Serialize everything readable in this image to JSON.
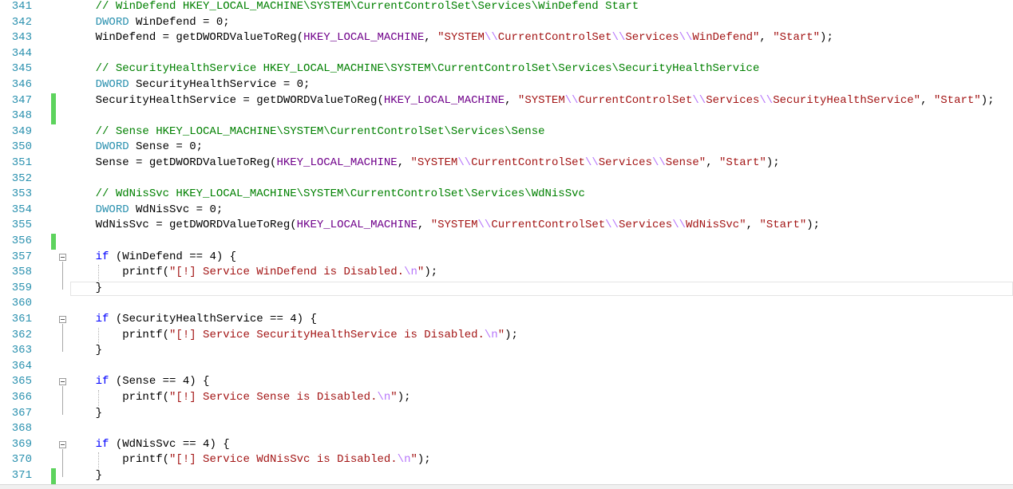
{
  "editor": {
    "lines": [
      {
        "n": "341",
        "tokens": [
          {
            "t": "    "
          },
          {
            "t": "// WinDefend HKEY_LOCAL_MACHINE\\SYSTEM\\CurrentControlSet\\Services\\WinDefend Start",
            "c": "comment"
          }
        ]
      },
      {
        "n": "342",
        "tokens": [
          {
            "t": "    "
          },
          {
            "t": "DWORD",
            "c": "type"
          },
          {
            "t": " WinDefend = 0;"
          }
        ]
      },
      {
        "n": "343",
        "tokens": [
          {
            "t": "    WinDefend = getDWORDValueToReg("
          },
          {
            "t": "HKEY_LOCAL_MACHINE",
            "c": "macro"
          },
          {
            "t": ", "
          },
          {
            "t": "\"SYSTEM",
            "c": "str"
          },
          {
            "t": "\\\\",
            "c": "esc"
          },
          {
            "t": "CurrentControlSet",
            "c": "str"
          },
          {
            "t": "\\\\",
            "c": "esc"
          },
          {
            "t": "Services",
            "c": "str"
          },
          {
            "t": "\\\\",
            "c": "esc"
          },
          {
            "t": "WinDefend\"",
            "c": "str"
          },
          {
            "t": ", "
          },
          {
            "t": "\"Start\"",
            "c": "str"
          },
          {
            "t": ");"
          }
        ]
      },
      {
        "n": "344",
        "tokens": []
      },
      {
        "n": "345",
        "tokens": [
          {
            "t": "    "
          },
          {
            "t": "// SecurityHealthService HKEY_LOCAL_MACHINE\\SYSTEM\\CurrentControlSet\\Services\\SecurityHealthService",
            "c": "comment"
          }
        ]
      },
      {
        "n": "346",
        "tokens": [
          {
            "t": "    "
          },
          {
            "t": "DWORD",
            "c": "type"
          },
          {
            "t": " SecurityHealthService = 0;"
          }
        ]
      },
      {
        "n": "347",
        "change": true,
        "tokens": [
          {
            "t": "    SecurityHealthService = getDWORDValueToReg("
          },
          {
            "t": "HKEY_LOCAL_MACHINE",
            "c": "macro"
          },
          {
            "t": ", "
          },
          {
            "t": "\"SYSTEM",
            "c": "str"
          },
          {
            "t": "\\\\",
            "c": "esc"
          },
          {
            "t": "CurrentControlSet",
            "c": "str"
          },
          {
            "t": "\\\\",
            "c": "esc"
          },
          {
            "t": "Services",
            "c": "str"
          },
          {
            "t": "\\\\",
            "c": "esc"
          },
          {
            "t": "SecurityHealthService\"",
            "c": "str"
          },
          {
            "t": ", "
          },
          {
            "t": "\"Start\"",
            "c": "str"
          },
          {
            "t": ");"
          }
        ]
      },
      {
        "n": "348",
        "change": true,
        "tokens": []
      },
      {
        "n": "349",
        "tokens": [
          {
            "t": "    "
          },
          {
            "t": "// Sense HKEY_LOCAL_MACHINE\\SYSTEM\\CurrentControlSet\\Services\\Sense",
            "c": "comment"
          }
        ]
      },
      {
        "n": "350",
        "tokens": [
          {
            "t": "    "
          },
          {
            "t": "DWORD",
            "c": "type"
          },
          {
            "t": " Sense = 0;"
          }
        ]
      },
      {
        "n": "351",
        "tokens": [
          {
            "t": "    Sense = getDWORDValueToReg("
          },
          {
            "t": "HKEY_LOCAL_MACHINE",
            "c": "macro"
          },
          {
            "t": ", "
          },
          {
            "t": "\"SYSTEM",
            "c": "str"
          },
          {
            "t": "\\\\",
            "c": "esc"
          },
          {
            "t": "CurrentControlSet",
            "c": "str"
          },
          {
            "t": "\\\\",
            "c": "esc"
          },
          {
            "t": "Services",
            "c": "str"
          },
          {
            "t": "\\\\",
            "c": "esc"
          },
          {
            "t": "Sense\"",
            "c": "str"
          },
          {
            "t": ", "
          },
          {
            "t": "\"Start\"",
            "c": "str"
          },
          {
            "t": ");"
          }
        ]
      },
      {
        "n": "352",
        "tokens": []
      },
      {
        "n": "353",
        "tokens": [
          {
            "t": "    "
          },
          {
            "t": "// WdNisSvc HKEY_LOCAL_MACHINE\\SYSTEM\\CurrentControlSet\\Services\\WdNisSvc",
            "c": "comment"
          }
        ]
      },
      {
        "n": "354",
        "tokens": [
          {
            "t": "    "
          },
          {
            "t": "DWORD",
            "c": "type"
          },
          {
            "t": " WdNisSvc = 0;"
          }
        ]
      },
      {
        "n": "355",
        "tokens": [
          {
            "t": "    WdNisSvc = getDWORDValueToReg("
          },
          {
            "t": "HKEY_LOCAL_MACHINE",
            "c": "macro"
          },
          {
            "t": ", "
          },
          {
            "t": "\"SYSTEM",
            "c": "str"
          },
          {
            "t": "\\\\",
            "c": "esc"
          },
          {
            "t": "CurrentControlSet",
            "c": "str"
          },
          {
            "t": "\\\\",
            "c": "esc"
          },
          {
            "t": "Services",
            "c": "str"
          },
          {
            "t": "\\\\",
            "c": "esc"
          },
          {
            "t": "WdNisSvc\"",
            "c": "str"
          },
          {
            "t": ", "
          },
          {
            "t": "\"Start\"",
            "c": "str"
          },
          {
            "t": ");"
          }
        ]
      },
      {
        "n": "356",
        "change": true,
        "tokens": []
      },
      {
        "n": "357",
        "fold": true,
        "tokens": [
          {
            "t": "    "
          },
          {
            "t": "if",
            "c": "kw"
          },
          {
            "t": " (WinDefend == 4) {"
          }
        ]
      },
      {
        "n": "358",
        "guide": true,
        "tokens": [
          {
            "t": "        printf("
          },
          {
            "t": "\"[!] Service WinDefend is Disabled.",
            "c": "str"
          },
          {
            "t": "\\n",
            "c": "esc"
          },
          {
            "t": "\"",
            "c": "str"
          },
          {
            "t": ");"
          }
        ]
      },
      {
        "n": "359",
        "current": true,
        "tokens": [
          {
            "t": "    }"
          }
        ]
      },
      {
        "n": "360",
        "tokens": []
      },
      {
        "n": "361",
        "fold": true,
        "tokens": [
          {
            "t": "    "
          },
          {
            "t": "if",
            "c": "kw"
          },
          {
            "t": " (SecurityHealthService == 4) {"
          }
        ]
      },
      {
        "n": "362",
        "guide": true,
        "tokens": [
          {
            "t": "        printf("
          },
          {
            "t": "\"[!] Service SecurityHealthService is Disabled.",
            "c": "str"
          },
          {
            "t": "\\n",
            "c": "esc"
          },
          {
            "t": "\"",
            "c": "str"
          },
          {
            "t": ");"
          }
        ]
      },
      {
        "n": "363",
        "tokens": [
          {
            "t": "    }"
          }
        ]
      },
      {
        "n": "364",
        "tokens": []
      },
      {
        "n": "365",
        "fold": true,
        "tokens": [
          {
            "t": "    "
          },
          {
            "t": "if",
            "c": "kw"
          },
          {
            "t": " (Sense == 4) {"
          }
        ]
      },
      {
        "n": "366",
        "guide": true,
        "tokens": [
          {
            "t": "        printf("
          },
          {
            "t": "\"[!] Service Sense is Disabled.",
            "c": "str"
          },
          {
            "t": "\\n",
            "c": "esc"
          },
          {
            "t": "\"",
            "c": "str"
          },
          {
            "t": ");"
          }
        ]
      },
      {
        "n": "367",
        "tokens": [
          {
            "t": "    }"
          }
        ]
      },
      {
        "n": "368",
        "tokens": []
      },
      {
        "n": "369",
        "fold": true,
        "tokens": [
          {
            "t": "    "
          },
          {
            "t": "if",
            "c": "kw"
          },
          {
            "t": " (WdNisSvc == 4) {"
          }
        ]
      },
      {
        "n": "370",
        "guide": true,
        "tokens": [
          {
            "t": "        printf("
          },
          {
            "t": "\"[!] Service WdNisSvc is Disabled.",
            "c": "str"
          },
          {
            "t": "\\n",
            "c": "esc"
          },
          {
            "t": "\"",
            "c": "str"
          },
          {
            "t": ");"
          }
        ]
      },
      {
        "n": "371",
        "change": true,
        "tokens": [
          {
            "t": "    }"
          }
        ]
      }
    ]
  },
  "colors": {
    "line_number": "#2b91af",
    "comment": "#008000",
    "keyword": "#0000ff",
    "type": "#2b91af",
    "macro": "#6f008a",
    "string": "#a31515",
    "escape": "#b776fb",
    "change_marker": "#5dd35d"
  },
  "icons": {
    "fold": "collapse-minus-icon"
  }
}
